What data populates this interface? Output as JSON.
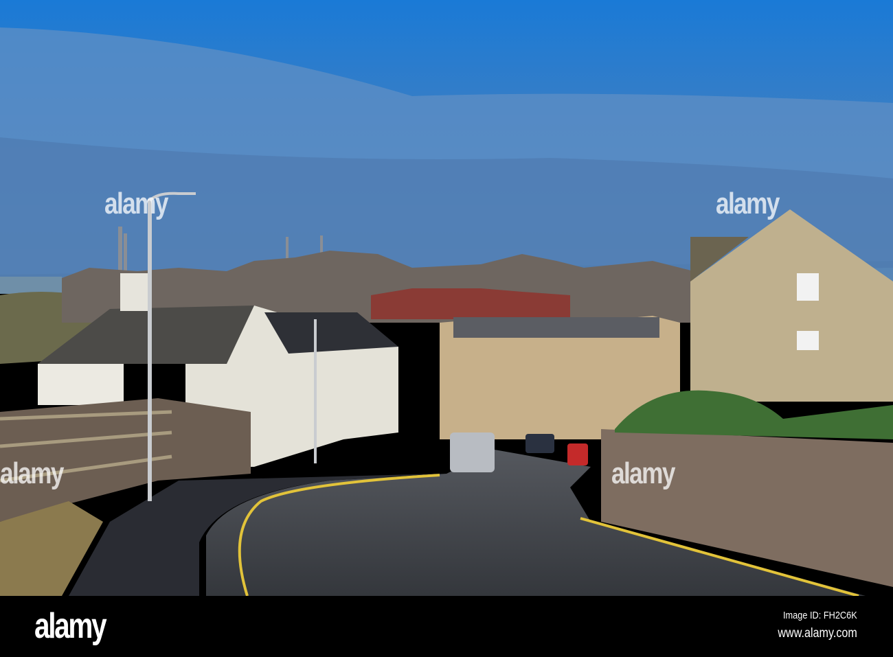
{
  "photo": {
    "subject": "coastal town street",
    "colors": {
      "sky_top": "#1e7fd6",
      "sky_low": "#4a7fb8",
      "road": "#3c3f45",
      "wall": "#7d6a5e",
      "house": "#c9b58f",
      "grass": "#4f8a3a"
    }
  },
  "watermark": {
    "text": "alamy"
  },
  "footer": {
    "logo": "alamy",
    "image_id": "Image ID: FH2C6K",
    "site": "www.alamy.com"
  }
}
